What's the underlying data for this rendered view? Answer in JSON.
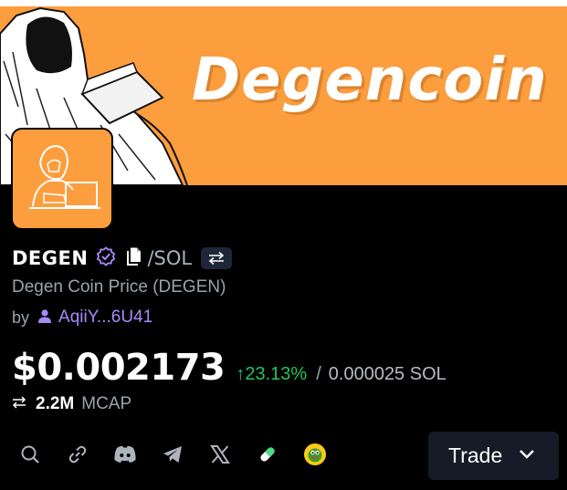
{
  "banner": {
    "title": "Degencoin",
    "background": "#fc9d3e"
  },
  "token": {
    "symbol": "DEGEN",
    "quote": "/SOL",
    "name": "Degen Coin Price (DEGEN)",
    "by_label": "by",
    "creator": "AqiiY...6U41",
    "price": "$0.002173",
    "change": "↑23.13%",
    "separator": "/",
    "price_sol": "0.000025 SOL",
    "mcap_value": "2.2M",
    "mcap_label": "MCAP"
  },
  "icons": {
    "verified": "verified-badge-icon",
    "copy": "copy-icon",
    "swap": "swap-icon",
    "user": "user-icon",
    "links": [
      "search-icon",
      "link-icon",
      "discord-icon",
      "telegram-icon",
      "x-icon",
      "pill-icon",
      "frog-icon"
    ]
  },
  "actions": {
    "trade_label": "Trade"
  },
  "colors": {
    "accent_purple": "#a78bfa",
    "positive": "#22c55e",
    "muted": "#9aa3ad",
    "trade_bg": "#151c28"
  }
}
